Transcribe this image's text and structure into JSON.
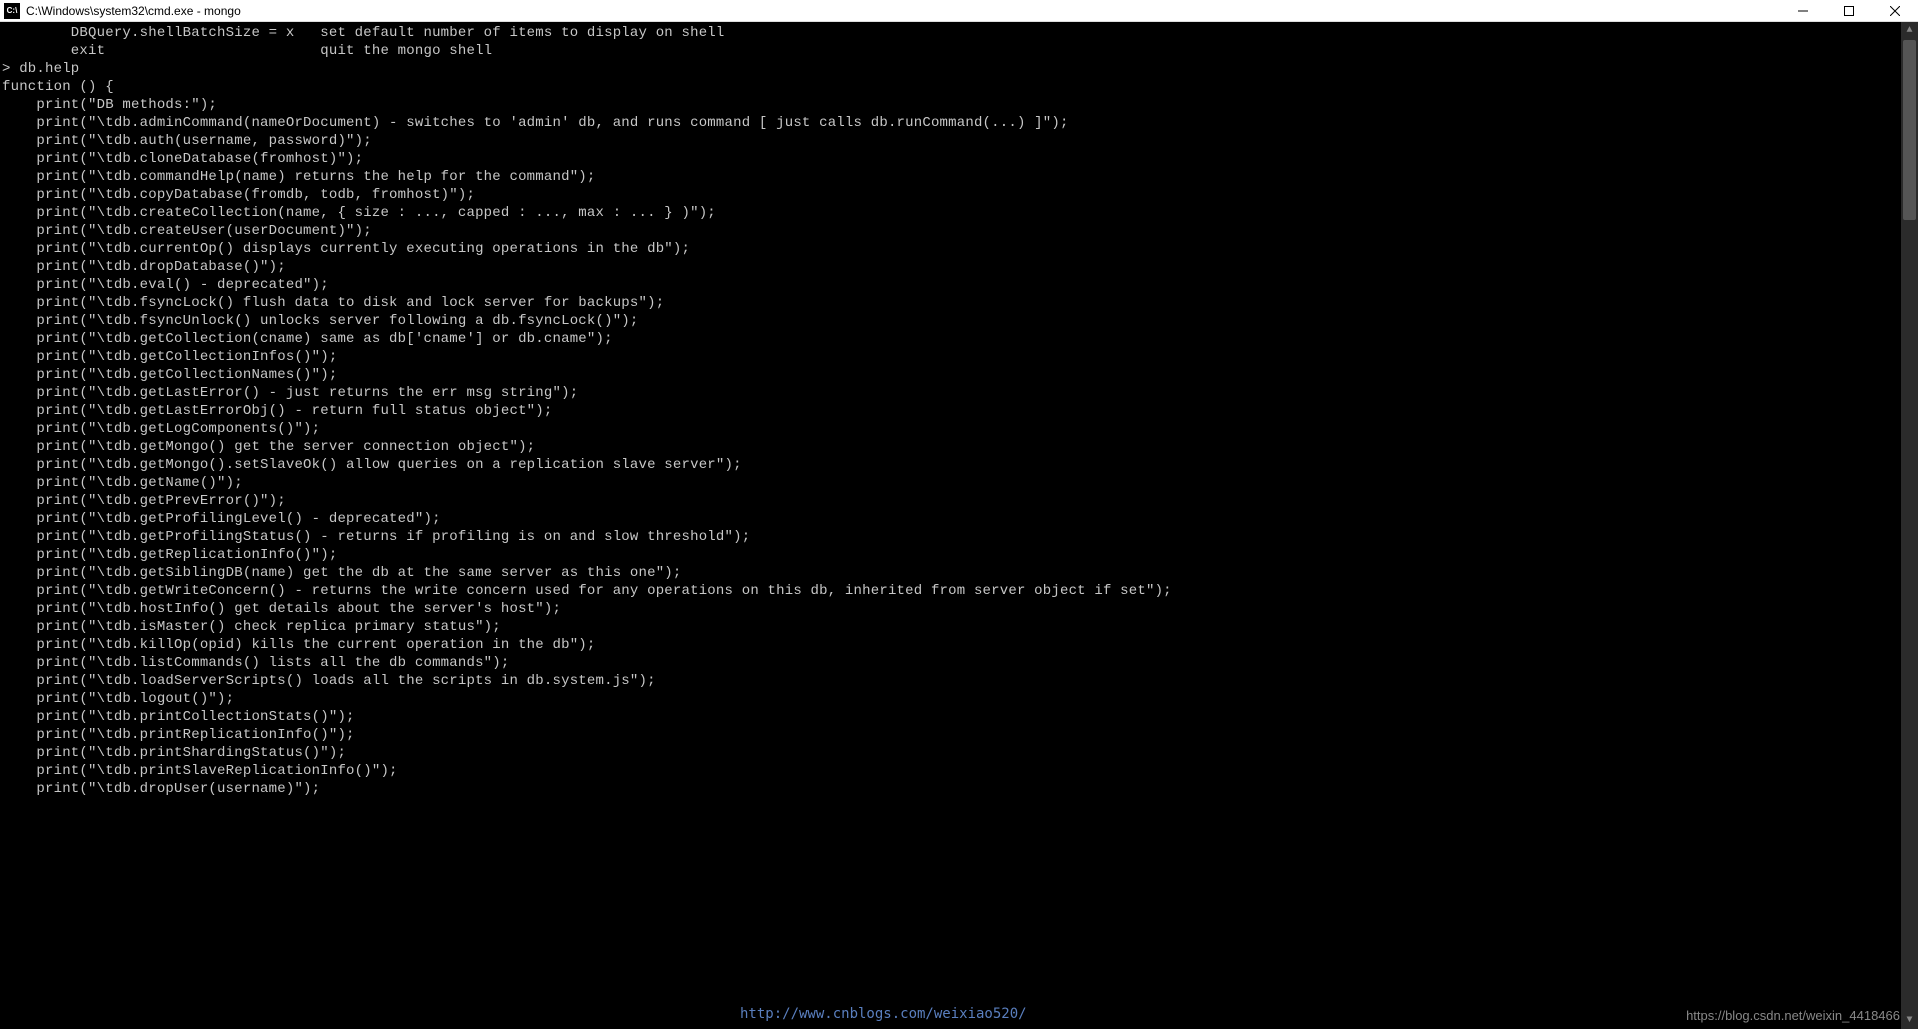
{
  "titlebar": {
    "icon_label": "C:\\",
    "title": "C:\\Windows\\system32\\cmd.exe - mongo"
  },
  "terminal": {
    "lines": [
      "        DBQuery.shellBatchSize = x   set default number of items to display on shell",
      "        exit                         quit the mongo shell",
      "> db.help",
      "function () {",
      "    print(\"DB methods:\");",
      "    print(\"\\tdb.adminCommand(nameOrDocument) - switches to 'admin' db, and runs command [ just calls db.runCommand(...) ]\");",
      "    print(\"\\tdb.auth(username, password)\");",
      "    print(\"\\tdb.cloneDatabase(fromhost)\");",
      "    print(\"\\tdb.commandHelp(name) returns the help for the command\");",
      "    print(\"\\tdb.copyDatabase(fromdb, todb, fromhost)\");",
      "    print(\"\\tdb.createCollection(name, { size : ..., capped : ..., max : ... } )\");",
      "    print(\"\\tdb.createUser(userDocument)\");",
      "    print(\"\\tdb.currentOp() displays currently executing operations in the db\");",
      "    print(\"\\tdb.dropDatabase()\");",
      "    print(\"\\tdb.eval() - deprecated\");",
      "    print(\"\\tdb.fsyncLock() flush data to disk and lock server for backups\");",
      "    print(\"\\tdb.fsyncUnlock() unlocks server following a db.fsyncLock()\");",
      "    print(\"\\tdb.getCollection(cname) same as db['cname'] or db.cname\");",
      "    print(\"\\tdb.getCollectionInfos()\");",
      "    print(\"\\tdb.getCollectionNames()\");",
      "    print(\"\\tdb.getLastError() - just returns the err msg string\");",
      "    print(\"\\tdb.getLastErrorObj() - return full status object\");",
      "    print(\"\\tdb.getLogComponents()\");",
      "    print(\"\\tdb.getMongo() get the server connection object\");",
      "    print(\"\\tdb.getMongo().setSlaveOk() allow queries on a replication slave server\");",
      "    print(\"\\tdb.getName()\");",
      "    print(\"\\tdb.getPrevError()\");",
      "    print(\"\\tdb.getProfilingLevel() - deprecated\");",
      "    print(\"\\tdb.getProfilingStatus() - returns if profiling is on and slow threshold\");",
      "    print(\"\\tdb.getReplicationInfo()\");",
      "    print(\"\\tdb.getSiblingDB(name) get the db at the same server as this one\");",
      "    print(\"\\tdb.getWriteConcern() - returns the write concern used for any operations on this db, inherited from server object if set\");",
      "    print(\"\\tdb.hostInfo() get details about the server's host\");",
      "    print(\"\\tdb.isMaster() check replica primary status\");",
      "    print(\"\\tdb.killOp(opid) kills the current operation in the db\");",
      "    print(\"\\tdb.listCommands() lists all the db commands\");",
      "    print(\"\\tdb.loadServerScripts() loads all the scripts in db.system.js\");",
      "    print(\"\\tdb.logout()\");",
      "    print(\"\\tdb.printCollectionStats()\");",
      "    print(\"\\tdb.printReplicationInfo()\");",
      "    print(\"\\tdb.printShardingStatus()\");",
      "    print(\"\\tdb.printSlaveReplicationInfo()\");",
      "    print(\"\\tdb.dropUser(username)\");"
    ]
  },
  "watermark": {
    "left": "http://www.cnblogs.com/weixiao520/",
    "right": "https://blog.csdn.net/weixin_4418466"
  }
}
